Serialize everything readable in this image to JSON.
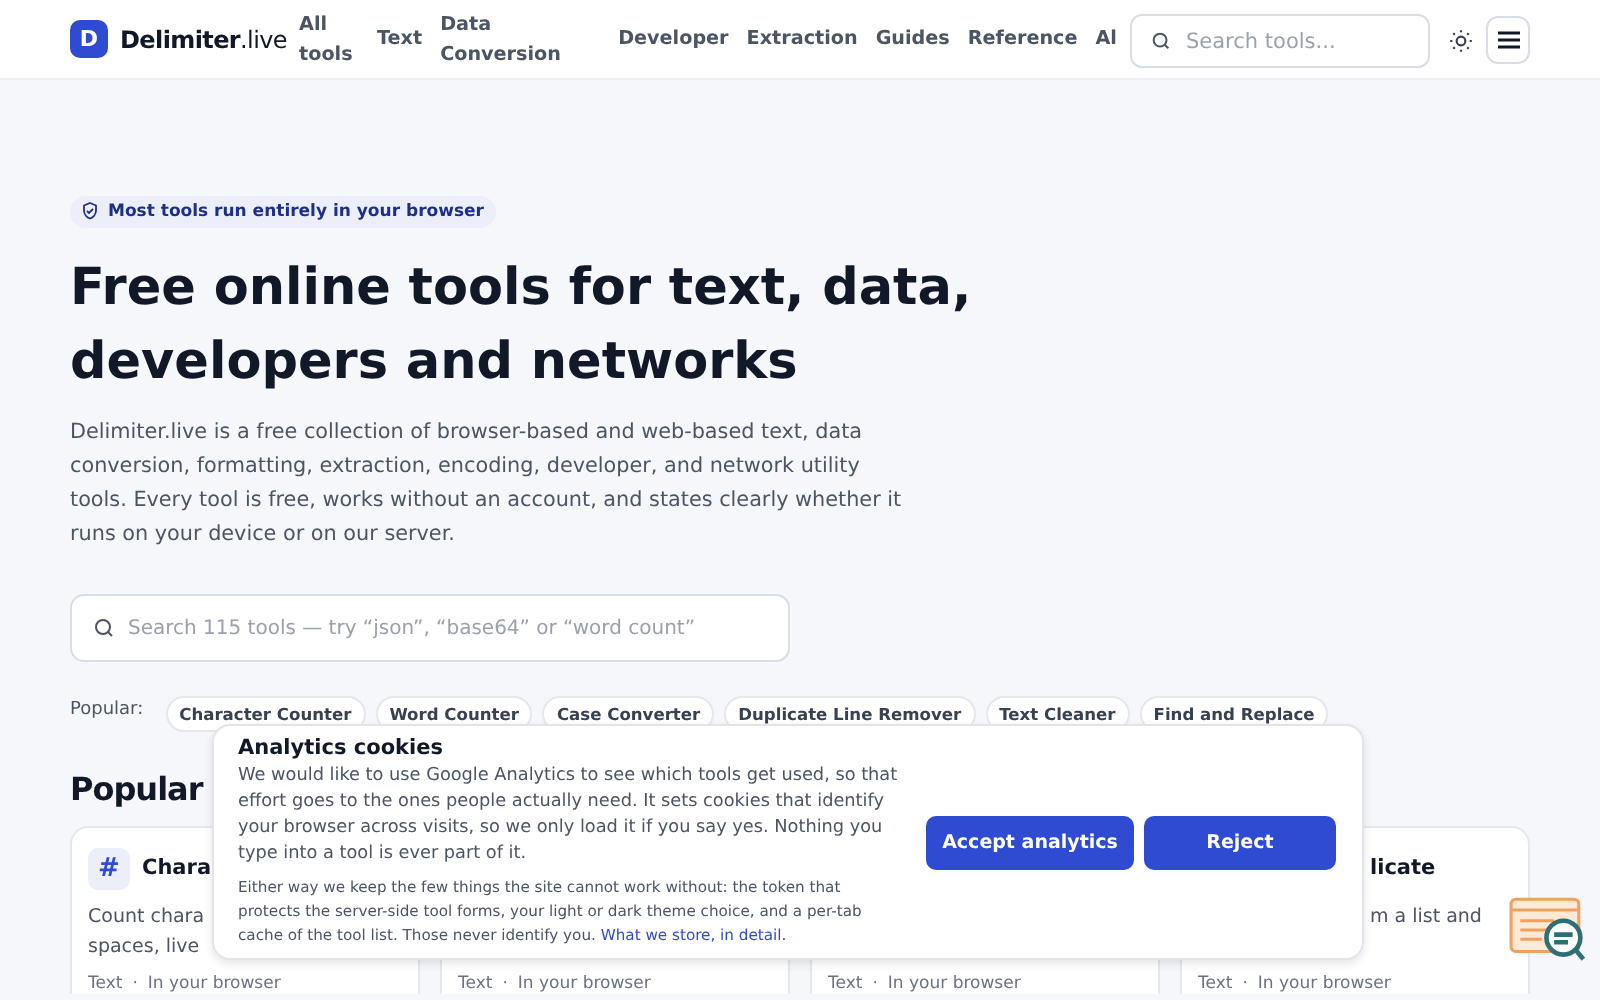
{
  "header": {
    "logo_letter": "D",
    "logo_name": "Delimiter",
    "logo_tld": ".live",
    "nav": [
      "All tools",
      "Text",
      "Data Conversion",
      "Developer",
      "Extraction",
      "Guides",
      "Reference",
      "Al"
    ],
    "search": {
      "placeholder": "Search tools..."
    }
  },
  "hero": {
    "badge": "Most tools run entirely in your browser",
    "title": "Free online tools for text, data, developers and networks",
    "description": "Delimiter.live is a free collection of browser-based and web-based text, data conversion, formatting, extraction, encoding, developer, and network utility tools. Every tool is free, works without an account, and states clearly whether it runs on your device or on our server.",
    "search": {
      "placeholder": "Search 115 tools — try “json”, “base64” or “word count”"
    },
    "popular_label": "Popular:",
    "popular": [
      "Character Counter",
      "Word Counter",
      "Case Converter",
      "Duplicate Line Remover",
      "Text Cleaner",
      "Find and Replace"
    ]
  },
  "section_title": "Popular",
  "cards": [
    {
      "icon": "#",
      "title": "Chara",
      "lines": [
        "Count chara",
        "spaces, live"
      ],
      "category": "Text",
      "separator": "·",
      "runs": "In your browser"
    },
    {
      "category": "Text",
      "separator": "·",
      "runs": "In your browser"
    },
    {
      "category": "Text",
      "separator": "·",
      "runs": "In your browser"
    },
    {
      "title": "licate",
      "lines": [
        "m a list and"
      ],
      "category": "Text",
      "separator": "·",
      "runs": "In your browser"
    }
  ],
  "cookie_banner": {
    "title": "Analytics cookies",
    "body": "We would like to use Google Analytics to see which tools get used, so that effort goes to the ones people actually need. It sets cookies that identify your browser across visits, so we only load it if you say yes. Nothing you type into a tool is ever part of it.",
    "note": "Either way we keep the few things the site cannot work without: the token that protects the server-side tool forms, your light or dark theme choice, and a per-tab cache of the tool list. Those never identify you.",
    "link": "What we store, in detail.",
    "buttons": [
      "Accept analytics",
      "Reject"
    ]
  }
}
